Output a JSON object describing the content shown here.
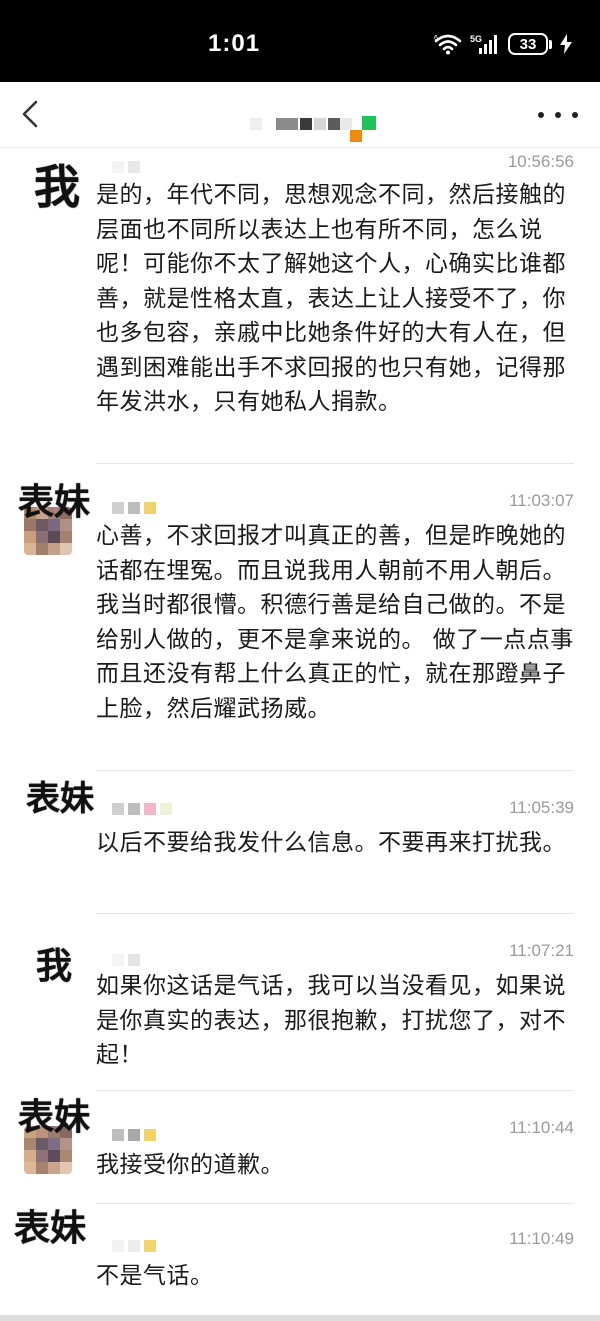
{
  "status_bar": {
    "time": "1:01",
    "network": "5G",
    "battery": "33"
  },
  "header": {
    "title": "",
    "back_icon": "chevron-left-icon",
    "more_icon": "more-dots-icon"
  },
  "messages": [
    {
      "tag": "我",
      "timestamp": "10:56:56",
      "text": "是的，年代不同，思想观念不同，然后接触的层面也不同所以表达上也有所不同，怎么说呢！可能你不太了解她这个人，心确实比谁都善，就是性格太直，表达上让人接受不了，你也多包容，亲戚中比她条件好的大有人在，但遇到困难能出手不求回报的也只有她，记得那年发洪水，只有她私人捐款。"
    },
    {
      "tag": "表妹",
      "timestamp": "11:03:07",
      "text": "心善，不求回报才叫真正的善，但是昨晚她的话都在埋冤。而且说我用人朝前不用人朝后。我当时都很懵。积德行善是给自己做的。不是给别人做的，更不是拿来说的。 做了一点点事而且还没有帮上什么真正的忙，就在那蹬鼻子上脸，然后耀武扬威。"
    },
    {
      "tag": "表妹",
      "timestamp": "11:05:39",
      "text": "以后不要给我发什么信息。不要再来打扰我。"
    },
    {
      "tag": "我",
      "timestamp": "11:07:21",
      "text": "如果你这话是气话，我可以当没看见，如果说是你真实的表达，那很抱歉，打扰您了，对不起！"
    },
    {
      "tag": "表妹",
      "timestamp": "11:10:44",
      "text": "我接受你的道歉。"
    },
    {
      "tag": "表妹",
      "timestamp": "11:10:49",
      "text": "不是气话。"
    }
  ],
  "colors": {
    "status_bar_bg": "#000000",
    "text": "#1b1b1b",
    "timestamp": "#9a9a9a",
    "divider": "#e6e6e6"
  }
}
